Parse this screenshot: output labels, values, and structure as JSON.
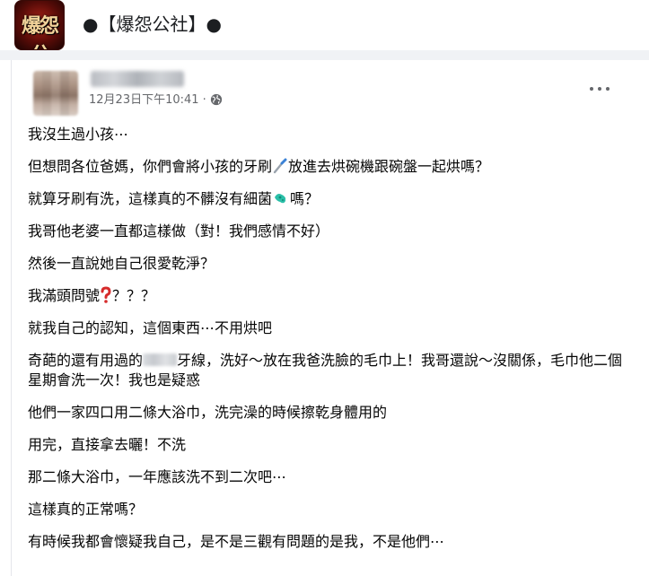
{
  "header": {
    "group_title": "●【爆怨公社】●",
    "logo_text": "爆怨公",
    "logo_icon": "group-logo-icon"
  },
  "post": {
    "timestamp": "12月23日下午10:41",
    "separator": "·",
    "privacy_icon": "globe-icon",
    "more_icon": "more-options-icon",
    "lines": [
      "我沒生過小孩⋯",
      "但想問各位爸媽，你們會將小孩的牙刷",
      "放進去烘碗機跟碗盤一起烘嗎？",
      "就算牙刷有洗，這樣真的不髒沒有細菌",
      "嗎？",
      "我哥他老婆一直都這樣做（對！我們感情不好）",
      "然後一直說她自己很愛乾淨？",
      "我滿頭問號",
      "？？？",
      "就我自己的認知，這個東西⋯不用烘吧",
      "奇葩的還有用過的",
      "牙線，洗好～放在我爸洗臉的毛巾上！我哥還說～沒關係，毛巾他二個星期會洗一次！我也是疑惑",
      "他們一家四口用二條大浴巾，洗完澡的時候擦乾身體用的",
      "用完，直接拿去曬！不洗",
      "那二條大浴巾，一年應該洗不到二次吧⋯",
      "這樣真的正常嗎？",
      "有時候我都會懷疑我自己，是不是三觀有問題的是我，不是他們⋯"
    ],
    "emoji_icons": [
      "toothbrush-icon",
      "microbe-icon",
      "red-question-icon"
    ]
  }
}
